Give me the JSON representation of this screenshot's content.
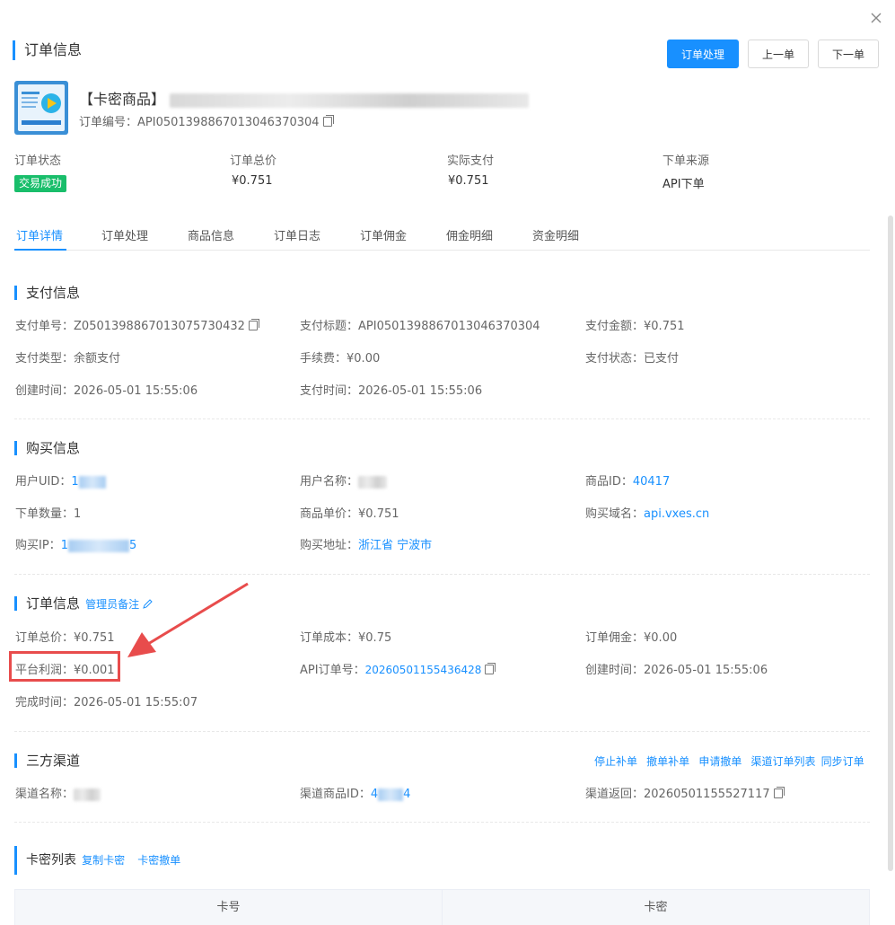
{
  "header": {
    "title": "订单信息",
    "btn_process": "订单处理",
    "btn_prev": "上一单",
    "btn_next": "下一单"
  },
  "product": {
    "name_prefix": "【卡密商品】",
    "order_no_label": "订单编号：",
    "order_no": "API05013988670130463703​04"
  },
  "summary": [
    {
      "label": "订单状态",
      "value": "交易成功"
    },
    {
      "label": "订单总价",
      "value": "¥0.751"
    },
    {
      "label": "实际支付",
      "value": "¥0.751"
    },
    {
      "label": "下单来源",
      "value": "API下单"
    }
  ],
  "tabs": [
    "订单详情",
    "订单处理",
    "商品信息",
    "订单日志",
    "订单佣金",
    "佣金明细",
    "资金明细"
  ],
  "pay": {
    "title": "支付信息",
    "pay_no_label": "支付单号：",
    "pay_no": "Z05013988670130757304​32",
    "pay_title_label": "支付标题：",
    "pay_title": "API05013988670130463703​04",
    "amount_label": "支付金额：",
    "amount": "¥0.751",
    "type_label": "支付类型：",
    "type": "余额支付",
    "fee_label": "手续费：",
    "fee": "¥0.00",
    "status_label": "支付状态：",
    "status": "已支付",
    "created_label": "创建时间：",
    "created": "2026-05-01 15:55:06",
    "paid_label": "支付时间：",
    "paid": "2026-05-01 15:55:06"
  },
  "buy": {
    "title": "购买信息",
    "uid_label": "用户UID：",
    "uid": "1",
    "uname_label": "用户名称：",
    "gid_label": "商品ID：",
    "gid": "40417",
    "qty_label": "下单数量：",
    "qty": "1",
    "price_label": "商品单价：",
    "price": "¥0.751",
    "domain_label": "购买域名：",
    "domain": "api.vxes.cn",
    "ip_label": "购买IP：",
    "ip_start": "1",
    "ip_end": "5",
    "addr_label": "购买地址：",
    "addr_province": "浙江省",
    "addr_city": "宁波市"
  },
  "order": {
    "title": "订单信息",
    "admin_note": "管理员备注",
    "total_label": "订单总价：",
    "total": "¥0.751",
    "cost_label": "订单成本：",
    "cost": "¥0.75",
    "commission_label": "订单佣金：",
    "commission": "¥0.00",
    "profit_label": "平台利润：",
    "profit": "¥0.001",
    "api_no_label": "API订单号：",
    "api_no": "20260501155436428",
    "created_label": "创建时间：",
    "created": "2026-05-01 15:55:06",
    "done_label": "完成时间：",
    "done": "2026-05-01 15:55:07"
  },
  "channel": {
    "title": "三方渠道",
    "actions": [
      "停止补单",
      "撤单补单",
      "申请撤单",
      "渠道订单列表",
      "同步订单"
    ],
    "name_label": "渠道名称：",
    "gid_label": "渠道商品ID：",
    "gid_start": "4",
    "gid_end": "4",
    "ret_label": "渠道返回：",
    "ret": "20260501155527117"
  },
  "cards": {
    "title": "卡密列表",
    "copy": "复制卡密",
    "revoke": "卡密撤单",
    "col_no": "卡号",
    "col_secret": "卡密"
  },
  "colors": {
    "accent": "#1890ff",
    "success": "#19be6b",
    "highlight": "#e84c4c"
  }
}
